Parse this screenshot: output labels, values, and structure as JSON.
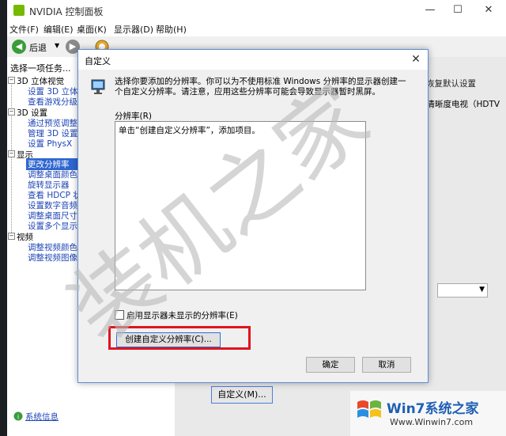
{
  "main_window": {
    "title": "NVIDIA 控制面板",
    "controls": [
      "—",
      "☐",
      "✕"
    ]
  },
  "menubar": [
    "文件(F)",
    "编辑(E)",
    "桌面(K)",
    "显示器(D)",
    "帮助(H)"
  ],
  "toolbar": {
    "back_label": "后退",
    "back_glyph": "◀",
    "forward_glyph": "▶",
    "dropdown_glyph": "▼"
  },
  "task_panel": {
    "header": "选择一项任务...",
    "tree": [
      {
        "label": "3D 立体视觉",
        "children": [
          "设置 3D 立体",
          "查看游戏分级"
        ]
      },
      {
        "label": "3D 设置",
        "children": [
          "通过预览调整",
          "管理 3D 设置",
          "设置 PhysX"
        ]
      },
      {
        "label": "显示",
        "children": [
          "更改分辨率",
          "调整桌面颜色",
          "旋转显示器",
          "查看 HDCP 状",
          "设置数字音频",
          "调整桌面尺寸",
          "设置多个显示"
        ]
      },
      {
        "label": "视频",
        "children": [
          "调整视频颜色",
          "调整视频图像"
        ]
      }
    ],
    "sysinfo": "系统信息"
  },
  "right_pane": {
    "restore_header": "恢复默认设置",
    "tv_item": "高清晰度电视（HDTV",
    "custom_button": "自定义(M)..."
  },
  "dialog": {
    "title": "自定义",
    "close": "✕",
    "description": "选择你要添加的分辨率。你可以为不使用标准 Windows 分辨率的显示器创建一个自定义分辨率。请注意，应用这些分辨率可能会导致显示器暂时黑屏。",
    "res_label": "分辨率(R)",
    "list_item": "单击“创建自定义分辨率”，添加项目。",
    "checkbox_label": "启用显示器未显示的分辨率(E)",
    "create_button": "创建自定义分辨率(C)...",
    "ok": "确定",
    "cancel": "取消"
  },
  "watermark": {
    "big_text": "装机之家",
    "brand": "Win7系统之家",
    "url": "Www.Winwin7.com"
  },
  "colors": {
    "nvidia_green": "#76b900",
    "highlight_red": "#e0141e",
    "selection_blue": "#2f66d0",
    "link_blue": "#1e45b5"
  }
}
